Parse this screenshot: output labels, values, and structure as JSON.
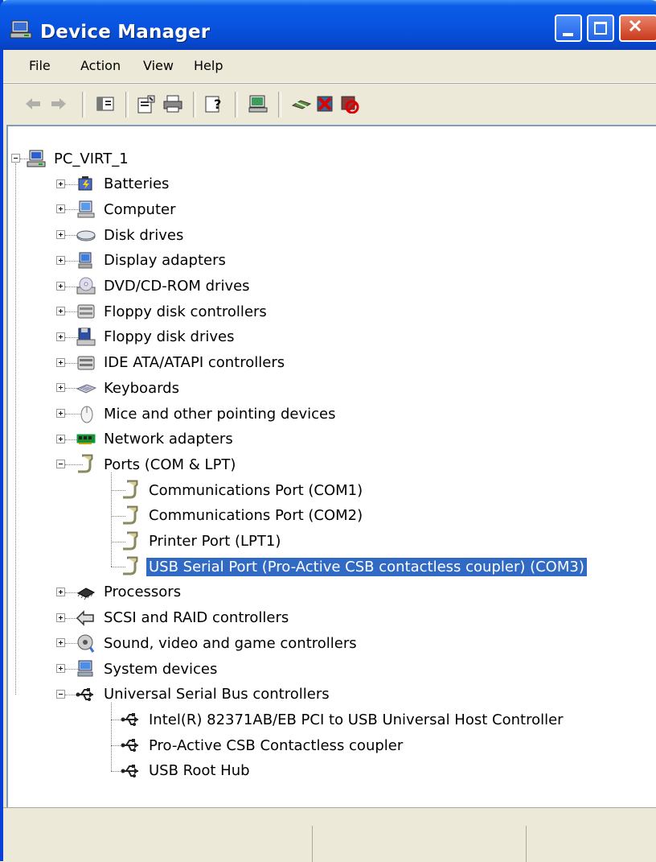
{
  "window": {
    "title": "Device Manager"
  },
  "menu": [
    "File",
    "Action",
    "View",
    "Help"
  ],
  "toolbar": {
    "buttons": [
      "back-icon",
      "forward-icon",
      "show-hide-tree-icon",
      "properties-icon",
      "print-icon",
      "help-icon",
      "scan-hardware-icon",
      "update-driver-icon",
      "uninstall-icon",
      "disable-icon"
    ]
  },
  "tree": {
    "root": "PC_VIRT_1",
    "categories": [
      {
        "label": "Batteries",
        "icon": "battery-icon",
        "expanded": false
      },
      {
        "label": "Computer",
        "icon": "computer-icon",
        "expanded": false
      },
      {
        "label": "Disk drives",
        "icon": "disk-drive-icon",
        "expanded": false
      },
      {
        "label": "Display adapters",
        "icon": "display-adapter-icon",
        "expanded": false
      },
      {
        "label": "DVD/CD-ROM drives",
        "icon": "cdrom-icon",
        "expanded": false
      },
      {
        "label": "Floppy disk controllers",
        "icon": "floppy-controller-icon",
        "expanded": false
      },
      {
        "label": "Floppy disk drives",
        "icon": "floppy-drive-icon",
        "expanded": false
      },
      {
        "label": "IDE ATA/ATAPI controllers",
        "icon": "ide-controller-icon",
        "expanded": false
      },
      {
        "label": "Keyboards",
        "icon": "keyboard-icon",
        "expanded": false
      },
      {
        "label": "Mice and other pointing devices",
        "icon": "mouse-icon",
        "expanded": false
      },
      {
        "label": "Network adapters",
        "icon": "network-adapter-icon",
        "expanded": false
      },
      {
        "label": "Ports (COM & LPT)",
        "icon": "port-icon",
        "expanded": true,
        "children": [
          {
            "label": "Communications Port (COM1)",
            "icon": "port-icon"
          },
          {
            "label": "Communications Port (COM2)",
            "icon": "port-icon"
          },
          {
            "label": "Printer Port (LPT1)",
            "icon": "port-icon"
          },
          {
            "label": "USB Serial Port (Pro-Active CSB contactless coupler) (COM3)",
            "icon": "port-icon",
            "selected": true
          }
        ]
      },
      {
        "label": "Processors",
        "icon": "processor-icon",
        "expanded": false
      },
      {
        "label": "SCSI and RAID controllers",
        "icon": "scsi-icon",
        "expanded": false
      },
      {
        "label": "Sound, video and game controllers",
        "icon": "sound-icon",
        "expanded": false
      },
      {
        "label": "System devices",
        "icon": "system-device-icon",
        "expanded": false
      },
      {
        "label": "Universal Serial Bus controllers",
        "icon": "usb-icon",
        "expanded": true,
        "children": [
          {
            "label": "Intel(R) 82371AB/EB PCI to USB Universal Host Controller",
            "icon": "usb-icon"
          },
          {
            "label": "Pro-Active CSB Contactless coupler",
            "icon": "usb-icon"
          },
          {
            "label": "USB Root Hub",
            "icon": "usb-icon"
          }
        ]
      }
    ]
  },
  "colors": {
    "titlebar": "#0854e0",
    "selection": "#316ac5",
    "chrome": "#ece9d8"
  }
}
